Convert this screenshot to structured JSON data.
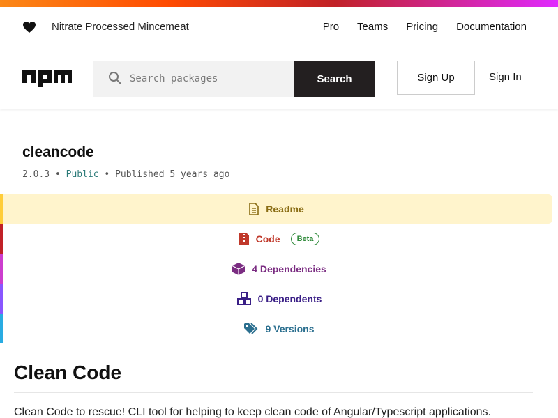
{
  "topbar": {
    "tagline": "Nitrate Processed Mincemeat",
    "nav": [
      "Pro",
      "Teams",
      "Pricing",
      "Documentation"
    ]
  },
  "header": {
    "logo_text": "npm",
    "search_placeholder": "Search packages",
    "search_label": "Search",
    "signup_label": "Sign Up",
    "signin_label": "Sign In"
  },
  "package": {
    "name": "cleancode",
    "version": "2.0.3",
    "visibility": "Public",
    "published": "Published 5 years ago",
    "sep": "•"
  },
  "tabs": {
    "readme": "Readme",
    "code": "Code",
    "code_badge": "Beta",
    "dependencies": "4 Dependencies",
    "dependents": "0 Dependents",
    "versions": "9 Versions"
  },
  "readme": {
    "heading": "Clean Code",
    "intro": "Clean Code to rescue! CLI tool for helping to keep clean code of Angular/Typescript applications."
  },
  "colors": {
    "readme_stripe": "#ffcd3a",
    "code_stripe": "#c12127",
    "deps_stripe": "#cc3dce",
    "dependents_stripe": "#8956ff",
    "versions_stripe": "#29abe2"
  }
}
